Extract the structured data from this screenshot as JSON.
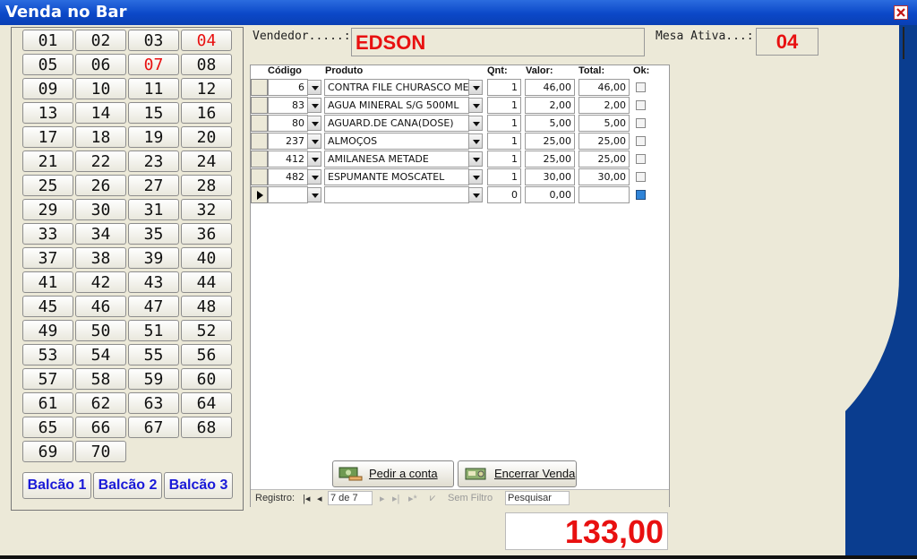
{
  "window": {
    "title": "Venda no Bar"
  },
  "tables": [
    "01",
    "02",
    "03",
    "04",
    "05",
    "06",
    "07",
    "08",
    "09",
    "10",
    "11",
    "12",
    "13",
    "14",
    "15",
    "16",
    "17",
    "18",
    "19",
    "20",
    "21",
    "22",
    "23",
    "24",
    "25",
    "26",
    "27",
    "28",
    "29",
    "30",
    "31",
    "32",
    "33",
    "34",
    "35",
    "36",
    "37",
    "38",
    "39",
    "40",
    "41",
    "42",
    "43",
    "44",
    "45",
    "46",
    "47",
    "48",
    "49",
    "50",
    "51",
    "52",
    "53",
    "54",
    "55",
    "56",
    "57",
    "58",
    "59",
    "60",
    "61",
    "62",
    "63",
    "64",
    "65",
    "66",
    "67",
    "68",
    "69",
    "70"
  ],
  "highlighted_tables": [
    "04",
    "07"
  ],
  "counters": [
    "Balcão 1",
    "Balcão 2",
    "Balcão 3"
  ],
  "header": {
    "seller_label": "Vendedor.....:",
    "seller_value": "EDSON",
    "table_label": "Mesa Ativa...:",
    "table_value": "04"
  },
  "grid": {
    "columns": {
      "code": "Código",
      "product": "Produto",
      "qty": "Qnt:",
      "price": "Valor:",
      "total": "Total:",
      "ok": "Ok:"
    },
    "rows": [
      {
        "code": "6",
        "product": "CONTRA FILE CHURASCO METADE",
        "qty": "1",
        "price": "46,00",
        "total": "46,00",
        "ok": false
      },
      {
        "code": "83",
        "product": "AGUA MINERAL S/G 500ML",
        "qty": "1",
        "price": "2,00",
        "total": "2,00",
        "ok": false
      },
      {
        "code": "80",
        "product": "AGUARD.DE CANA(DOSE)",
        "qty": "1",
        "price": "5,00",
        "total": "5,00",
        "ok": false
      },
      {
        "code": "237",
        "product": "ALMOÇOS",
        "qty": "1",
        "price": "25,00",
        "total": "25,00",
        "ok": false
      },
      {
        "code": "412",
        "product": "AMILANESA METADE",
        "qty": "1",
        "price": "25,00",
        "total": "25,00",
        "ok": false
      },
      {
        "code": "482",
        "product": "ESPUMANTE MOSCATEL",
        "qty": "1",
        "price": "30,00",
        "total": "30,00",
        "ok": false
      },
      {
        "code": "",
        "product": "",
        "qty": "0",
        "price": "0,00",
        "total": "",
        "ok": true
      }
    ]
  },
  "actions": {
    "order_bill": "Pedir a conta",
    "close_sale": "Encerrar Venda"
  },
  "navigator": {
    "label": "Registro:",
    "position": "7 de 7",
    "filter": "Sem Filtro",
    "search": "Pesquisar"
  },
  "grand_total": "133,00",
  "colors": {
    "highlight": "#e81010",
    "counter_text": "#1a1ad8",
    "titlebar": "#0b48c8"
  }
}
